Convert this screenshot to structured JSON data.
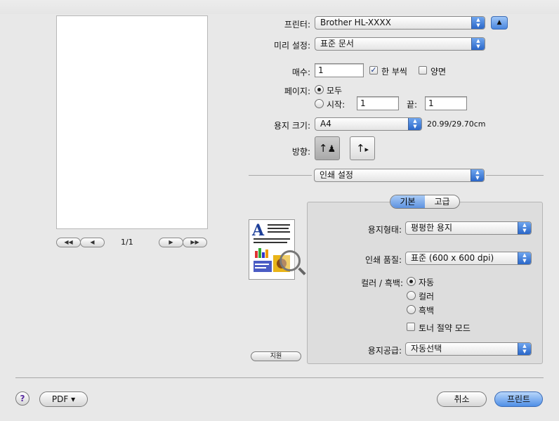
{
  "printer": {
    "label": "프린터:",
    "value": "Brother HL-XXXX"
  },
  "preset": {
    "label": "미리 설정:",
    "value": "표준 문서"
  },
  "copies": {
    "label": "매수:",
    "value": "1",
    "collated_label": "한 부씩",
    "collated_checked": true,
    "duplex_label": "양면",
    "duplex_checked": false
  },
  "pages": {
    "label": "페이지:",
    "all_label": "모두",
    "from_label": "시작:",
    "from_value": "1",
    "to_label": "끝:",
    "to_value": "1",
    "selected": "all"
  },
  "paper_size": {
    "label": "용지 크기:",
    "value": "A4",
    "dimensions": "20.99/29.70cm"
  },
  "orientation": {
    "label": "방향:",
    "selected": "portrait"
  },
  "section_popup": {
    "value": "인쇄 설정"
  },
  "tabs": [
    {
      "label": "기본",
      "active": true
    },
    {
      "label": "고급",
      "active": false
    }
  ],
  "media_type": {
    "label": "용지형태:",
    "value": "평평한 용지"
  },
  "print_quality": {
    "label": "인쇄 품질:",
    "value": "표준 (600 x 600 dpi)"
  },
  "color_mode": {
    "label": "컬러 / 흑백:",
    "options": [
      "자동",
      "컬러",
      "흑백"
    ],
    "selected": "자동"
  },
  "toner_save": {
    "label": "토너 절약 모드",
    "checked": false
  },
  "paper_source": {
    "label": "용지공급:",
    "value": "자동선택"
  },
  "support_button": "지원",
  "preview": {
    "page_indicator": "1/1"
  },
  "bottom": {
    "help": "?",
    "pdf": "PDF ▾",
    "cancel": "취소",
    "print": "프린트"
  },
  "colors": {
    "accent": "#4f8fe6",
    "background": "#e8e8e8"
  }
}
